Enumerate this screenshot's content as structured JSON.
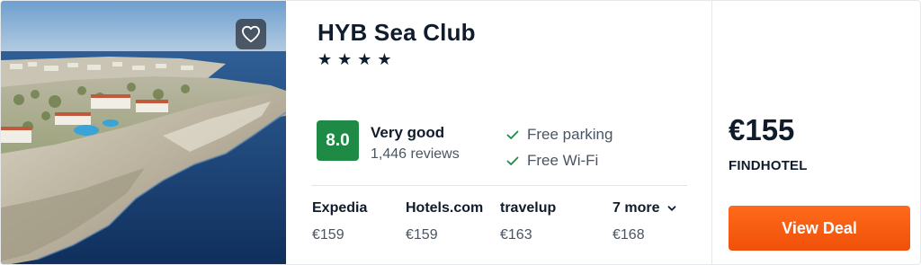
{
  "hotel": {
    "name": "HYB Sea Club",
    "star_count": 4,
    "star_glyph": "★"
  },
  "photo": {
    "favorite_icon": "heart-outline-icon"
  },
  "rating": {
    "score": "8.0",
    "label": "Very good",
    "reviews": "1,446 reviews",
    "color": "#1f8a46"
  },
  "amenities": [
    {
      "label": "Free parking",
      "icon": "check-icon"
    },
    {
      "label": "Free Wi-Fi",
      "icon": "check-icon"
    }
  ],
  "providers": [
    {
      "name": "Expedia",
      "price": "€159"
    },
    {
      "name": "Hotels.com",
      "price": "€159"
    },
    {
      "name": "travelup",
      "price": "€163"
    }
  ],
  "more_providers": {
    "label": "7 more",
    "price": "€168",
    "icon": "chevron-down-icon"
  },
  "deal": {
    "price": "€155",
    "provider": "FINDHOTEL",
    "button_label": "View Deal",
    "button_color": "#f4580f"
  }
}
